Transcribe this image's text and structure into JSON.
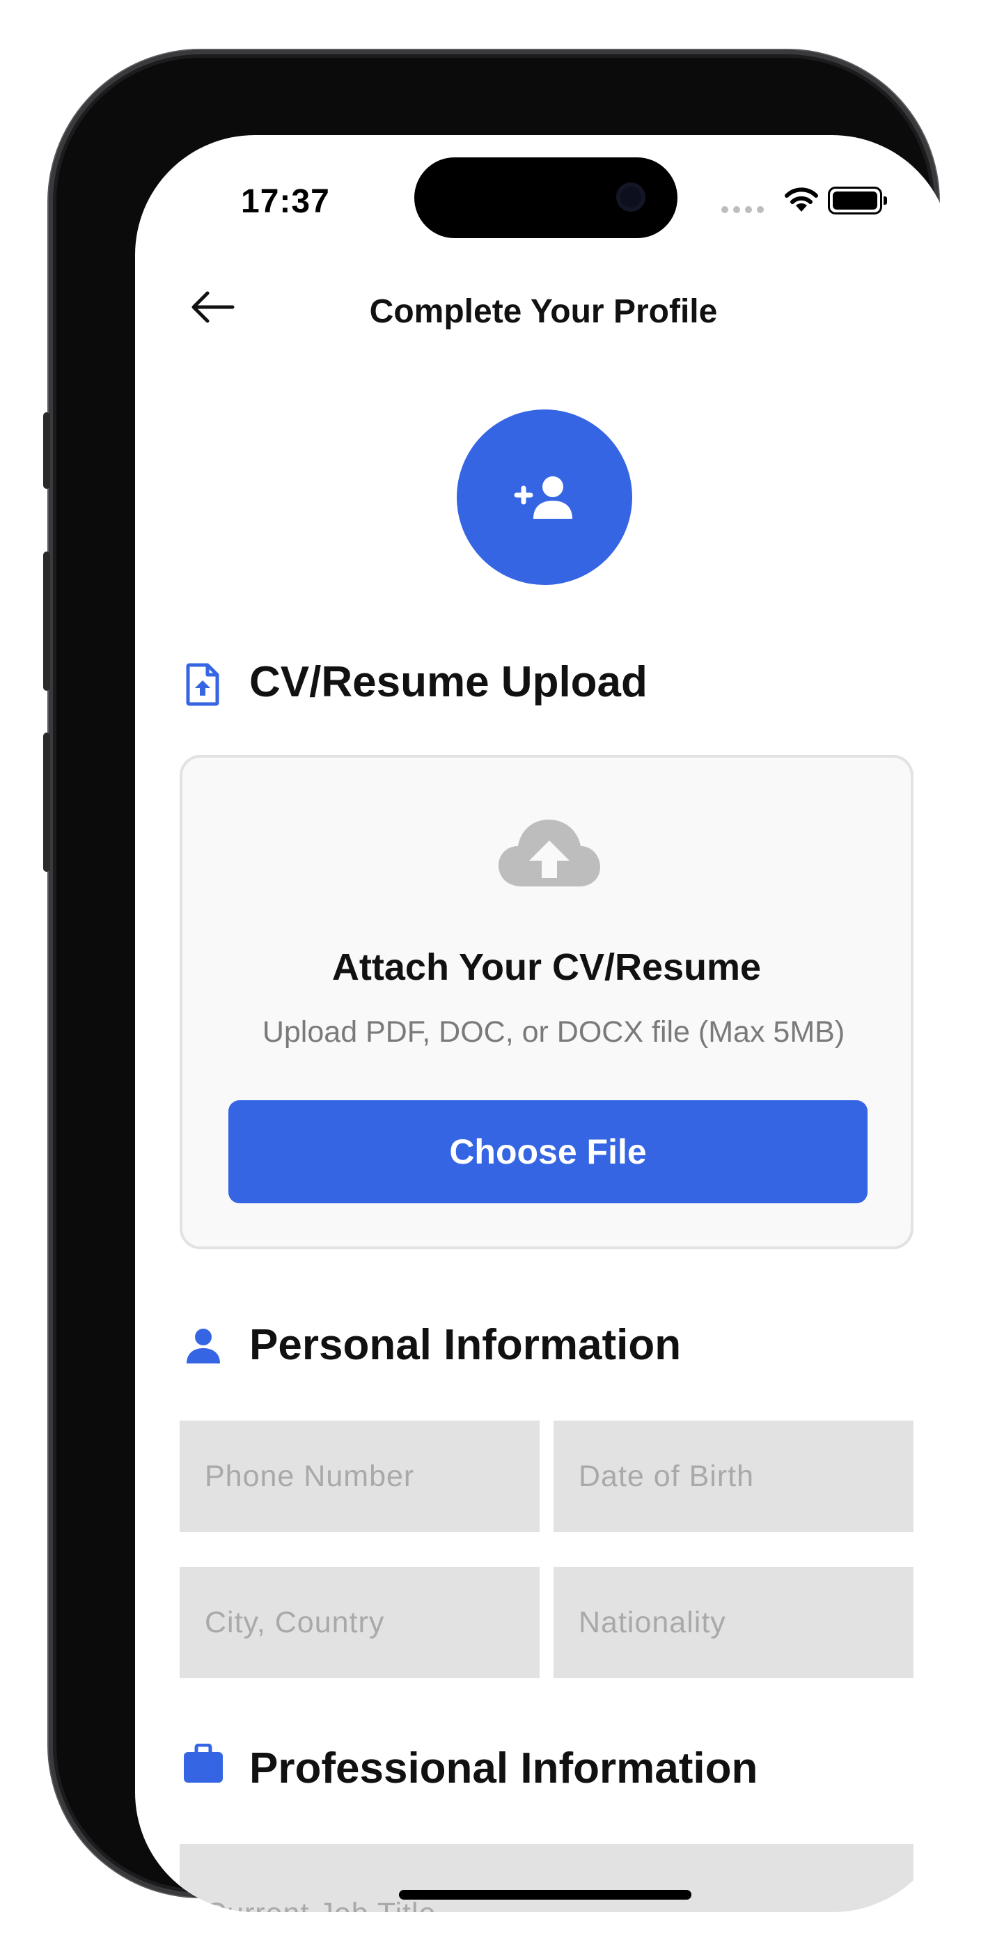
{
  "status_bar": {
    "time": "17:37"
  },
  "header": {
    "title": "Complete Your Profile"
  },
  "cv_section": {
    "title": "CV/Resume Upload",
    "card_title": "Attach Your CV/Resume",
    "card_subtitle": "Upload PDF, DOC, or DOCX file (Max 5MB)",
    "button_label": "Choose File"
  },
  "personal_section": {
    "title": "Personal Information",
    "fields": {
      "phone": {
        "placeholder": "Phone Number",
        "value": ""
      },
      "dob": {
        "placeholder": "Date of Birth",
        "value": ""
      },
      "city": {
        "placeholder": "City, Country",
        "value": ""
      },
      "nationality": {
        "placeholder": "Nationality",
        "value": ""
      }
    }
  },
  "professional_section": {
    "title": "Professional Information",
    "fields": {
      "job_title": {
        "placeholder": "Current Job Title",
        "value": ""
      }
    }
  },
  "colors": {
    "accent": "#3565e3",
    "field_bg": "#e3e2e3",
    "icon_gray": "#bdbdbd"
  },
  "icons": {
    "back": "arrow-left-icon",
    "avatar": "add-person-icon",
    "cv": "file-upload-icon",
    "cloud": "cloud-upload-icon",
    "personal": "person-icon",
    "professional": "briefcase-icon"
  }
}
